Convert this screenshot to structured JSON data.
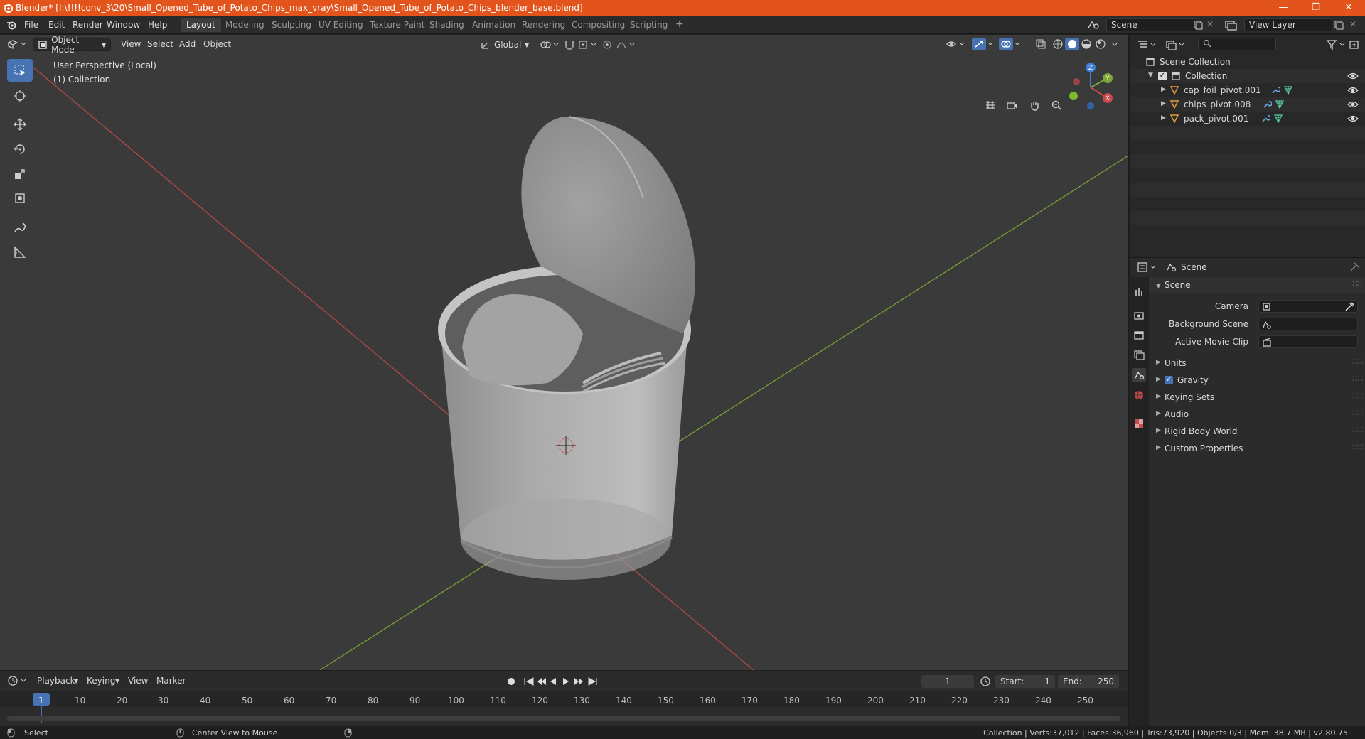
{
  "window": {
    "title": "Blender* [I:\\!!!!conv_3\\20\\Small_Opened_Tube_of_Potato_Chips_max_vray\\Small_Opened_Tube_of_Potato_Chips_blender_base.blend]",
    "minimize": "—",
    "maximize": "❐",
    "close": "✕"
  },
  "menu": {
    "items": [
      "File",
      "Edit",
      "Render",
      "Window",
      "Help"
    ],
    "workspaces": [
      "Layout",
      "Modeling",
      "Sculpting",
      "UV Editing",
      "Texture Paint",
      "Shading",
      "Animation",
      "Rendering",
      "Compositing",
      "Scripting"
    ],
    "active_workspace": "Layout",
    "add_tab": "+",
    "scene": "Scene",
    "view_layer": "View Layer"
  },
  "viewport": {
    "mode": "Object Mode",
    "menus": [
      "View",
      "Select",
      "Add",
      "Object"
    ],
    "transform_orientation": "Global",
    "overlay_line1": "User Perspective (Local)",
    "overlay_line2": "(1) Collection",
    "gizmo": {
      "x": "X",
      "y": "Y",
      "z": "Z"
    }
  },
  "outliner": {
    "root": "Scene Collection",
    "collection": "Collection",
    "objects": [
      "cap_foil_pivot.001",
      "chips_pivot.008",
      "pack_pivot.001"
    ]
  },
  "properties": {
    "context": "Scene",
    "panel_title": "Scene",
    "fields": [
      {
        "label": "Camera"
      },
      {
        "label": "Background Scene"
      },
      {
        "label": "Active Movie Clip"
      }
    ],
    "sections": [
      "Units",
      "Gravity",
      "Keying Sets",
      "Audio",
      "Rigid Body World",
      "Custom Properties"
    ],
    "gravity_checked": true
  },
  "timeline": {
    "menus": [
      "Playback",
      "Keying",
      "View",
      "Marker"
    ],
    "current_frame": "1",
    "start_label": "Start:",
    "start": "1",
    "end_label": "End:",
    "end": "250",
    "ruler": [
      "1",
      "10",
      "20",
      "30",
      "40",
      "50",
      "60",
      "70",
      "80",
      "90",
      "100",
      "110",
      "120",
      "130",
      "140",
      "150",
      "160",
      "170",
      "180",
      "190",
      "200",
      "210",
      "220",
      "230",
      "240",
      "250"
    ]
  },
  "status": {
    "select": "Select",
    "center_view": "Center View to Mouse",
    "stats": "Collection | Verts:37,012 | Faces:36,960 | Tris:73,920 | Objects:0/3 | Mem: 38.7 MB | v2.80.75"
  },
  "colors": {
    "accent": "#4772b3",
    "titlebar": "#e2541b",
    "axis_x": "#c94a4a",
    "axis_y": "#7fa83a",
    "axis_z": "#3b7fd6"
  }
}
